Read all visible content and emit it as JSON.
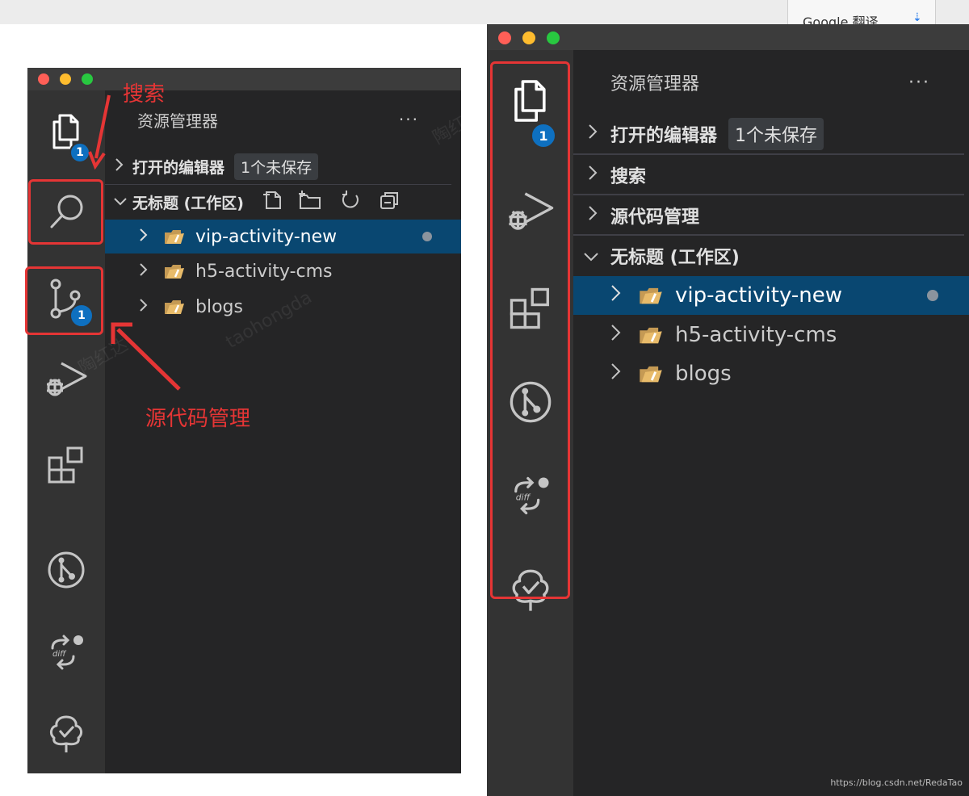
{
  "browser": {
    "translate_tab_label": "Google 翻译"
  },
  "explorer": {
    "title": "资源管理器",
    "more_label": "···",
    "open_editors_label": "打开的编辑器",
    "unsaved_label": "1个未保存",
    "search_section_label": "搜索",
    "scm_section_label": "源代码管理",
    "workspace_label": "无标题 (工作区)",
    "folders": [
      {
        "name": "vip-activity-new",
        "selected": true,
        "modified": true
      },
      {
        "name": "h5-activity-cms",
        "selected": false,
        "modified": false
      },
      {
        "name": "blogs",
        "selected": false,
        "modified": false
      }
    ]
  },
  "activity_bar": {
    "left_icons": [
      "files-icon",
      "search-icon",
      "source-control-icon",
      "run-debug-icon",
      "extensions-icon",
      "gitlens-icon",
      "diff-icon",
      "tree-check-icon"
    ],
    "right_icons": [
      "files-icon",
      "run-debug-icon",
      "extensions-icon",
      "gitlens-icon",
      "diff-icon",
      "tree-check-icon"
    ],
    "files_badge": "1",
    "scm_badge": "1"
  },
  "annotations": {
    "search": "搜索",
    "scm": "源代码管理"
  },
  "watermark": {
    "credit": "https://blog.csdn.net/RedaTao"
  },
  "colors": {
    "sidebar_bg": "#252526",
    "activity_bar_bg": "#333333",
    "selection_bg": "#094771",
    "badge_bg": "#0e70c0",
    "annotation_red": "#e53535"
  }
}
